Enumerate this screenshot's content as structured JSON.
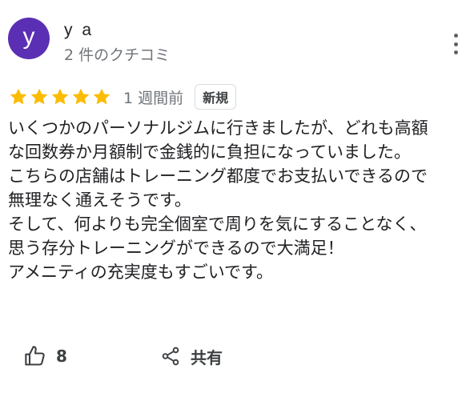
{
  "reviewer": {
    "avatar_letter": "y",
    "avatar_color": "#5b2fb4",
    "name": "y a",
    "review_count": "2 件のクチコミ"
  },
  "menu": {
    "icon": "more-vertical-icon"
  },
  "rating": {
    "stars": 5,
    "max_stars": 5,
    "star_color": "#fbbc04",
    "date": "1 週間前",
    "badge": "新規"
  },
  "review": {
    "text": "いくつかのパーソナルジムに行きましたが、どれも高額\nな回数券か月額制で金銭的に負担になっていました。\nこちらの店舗はトレーニング都度でお支払いできるので\n無理なく通えそうです。\nそして、何よりも完全個室で周りを気にすることなく、\n思う存分トレーニングができるので大満足！\nアメニティの充実度もすごいです。"
  },
  "actions": {
    "like_icon": "thumbs-up-icon",
    "like_count": "8",
    "share_icon": "share-icon",
    "share_label": "共有"
  }
}
